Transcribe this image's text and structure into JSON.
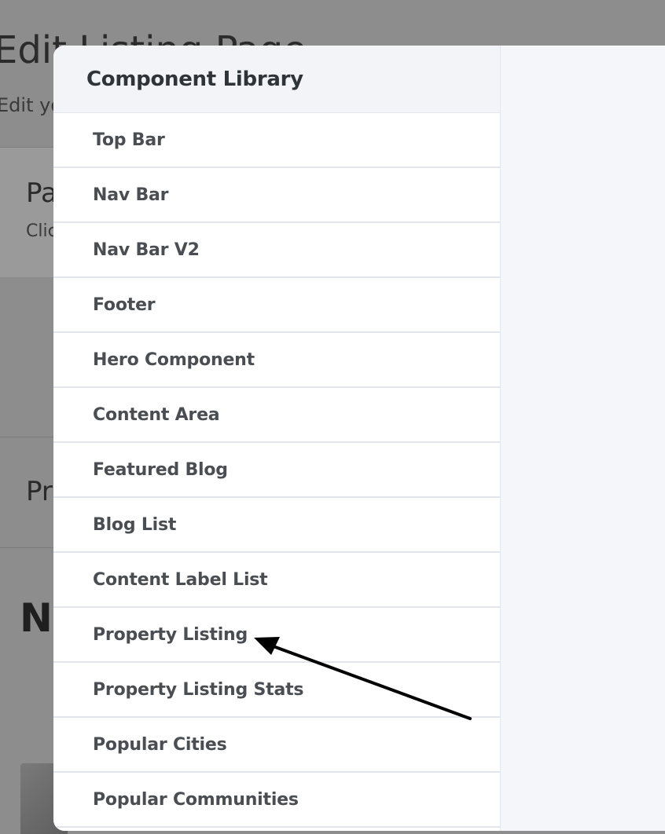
{
  "background": {
    "title": "Edit Listing Page",
    "subtitle": "Edit your",
    "card_title": "Page",
    "card_text": "Click",
    "section_title": "Pro",
    "heading": "No"
  },
  "component_library": {
    "title": "Component Library",
    "items": [
      {
        "label": "Top Bar"
      },
      {
        "label": "Nav Bar"
      },
      {
        "label": "Nav Bar V2"
      },
      {
        "label": "Footer"
      },
      {
        "label": "Hero Component"
      },
      {
        "label": "Content Area"
      },
      {
        "label": "Featured Blog"
      },
      {
        "label": "Blog List"
      },
      {
        "label": "Content Label List"
      },
      {
        "label": "Property Listing"
      },
      {
        "label": "Property Listing Stats"
      },
      {
        "label": "Popular Cities"
      },
      {
        "label": "Popular Communities"
      }
    ]
  },
  "colors": {
    "overlay": "#8f8f8f",
    "panel_bg": "#ffffff",
    "header_bg": "#f3f4f8",
    "item_text": "#4a4d51",
    "title_text": "#2f3438",
    "annotation_arrow": "#000000"
  },
  "annotation": {
    "type": "arrow",
    "points_to": "Property Listing"
  }
}
